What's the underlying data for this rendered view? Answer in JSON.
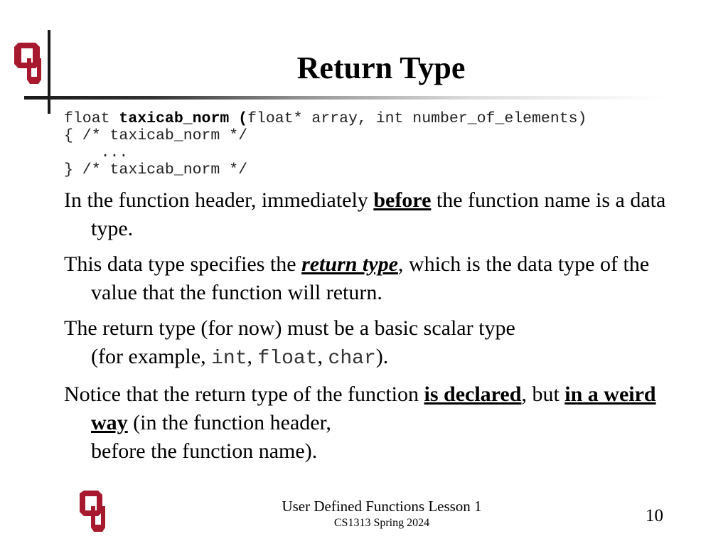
{
  "slide": {
    "title": "Return Type",
    "code": {
      "line1_type": "float ",
      "line1_name": "taxicab_norm (",
      "line1_params": "float* array, int number_of_elements)",
      "line2": "{ /* taxicab_norm */",
      "line3": "    ...",
      "line4": "} /* taxicab_norm */"
    },
    "bullets": [
      {
        "pre": "In the function header, immediately ",
        "emph": "before",
        "post": " the function name is a data type."
      },
      {
        "pre": "This data type specifies the ",
        "emph": "return type",
        "post": ", which is the data type of the value that the function will return."
      },
      {
        "line1": "The return type (for now) must be a basic scalar type",
        "pre": "(for example, ",
        "code1": "int",
        "sep1": ", ",
        "code2": "float",
        "sep2": ", ",
        "code3": "char",
        "post": ")."
      },
      {
        "pre": "Notice that the return type of the function ",
        "emph1": "is declared",
        "mid": ", but ",
        "emph2": "in a weird way",
        "post": " (in the function header,",
        "line3": "before the function name)."
      }
    ],
    "footer": {
      "line1": "User Defined Functions Lesson 1",
      "line2": "CS1313 Spring 2024"
    },
    "page_number": "10",
    "brand_color": "#a6192e"
  }
}
